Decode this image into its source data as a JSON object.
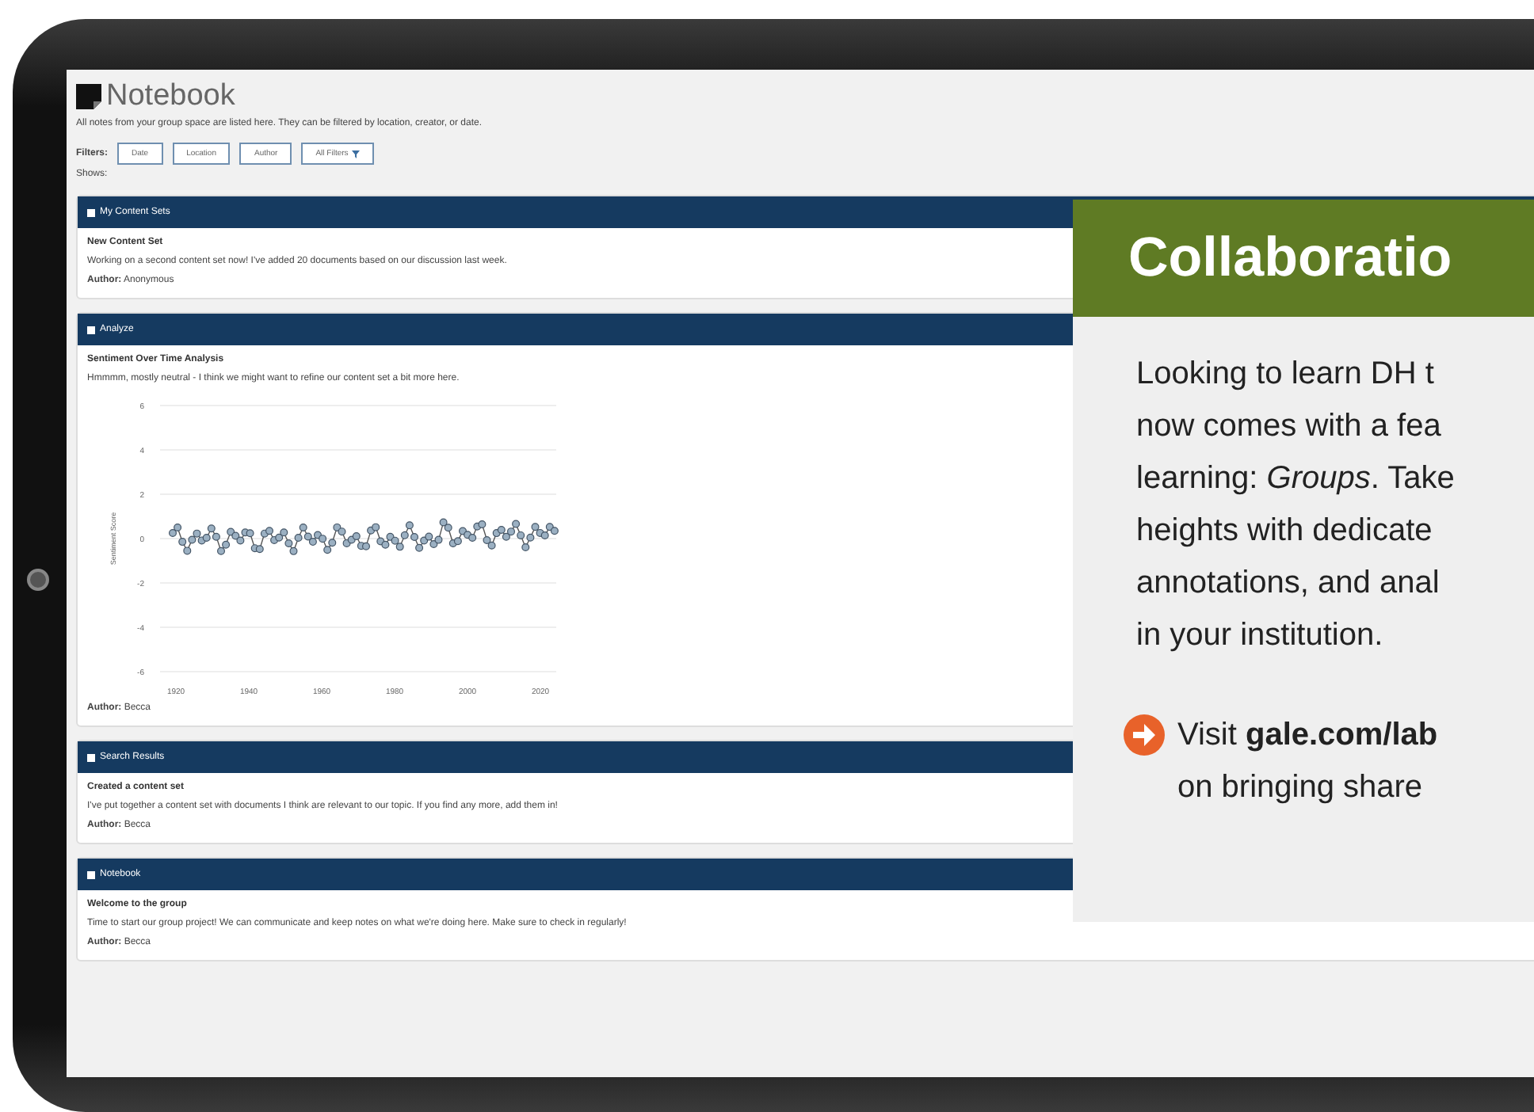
{
  "page": {
    "title": "Notebook",
    "description": "All notes from your group space are listed here. They can be filtered by location, creator, or date.",
    "filters_label": "Filters:",
    "filters": [
      {
        "label": "Date",
        "kind": "plain"
      },
      {
        "label": "Location",
        "kind": "plain"
      },
      {
        "label": "Author",
        "kind": "plain"
      },
      {
        "label": "All Filters",
        "kind": "dropdown"
      }
    ],
    "shows_label": "Shows:"
  },
  "panels": [
    {
      "header": "My Content Sets",
      "title": "New Content Set",
      "body": "Working on a second content set now! I've added 20 documents based on our discussion last week.",
      "author": "**Author:** Anonymous"
    },
    {
      "header": "Analyze",
      "title": "Sentiment Over Time Analysis",
      "body": "Hmmmm, mostly neutral - I think we might want to refine our content set a bit more here.",
      "chart": {
        "y_labels": [
          "6",
          "4",
          "2",
          "0",
          "-2",
          "-4",
          "-6"
        ],
        "x_labels": [
          "1920",
          "1940",
          "1960",
          "1980",
          "2000",
          "2020"
        ],
        "y_title": "Sentiment Score"
      },
      "author": "**Author:** Becca"
    },
    {
      "header": "Search Results",
      "title": "Created a content set",
      "body": "I've put together a content set with documents I think are relevant to our topic. If you find any more, add them in!",
      "author": "**Author:** Becca"
    },
    {
      "header": "Notebook",
      "title": "Welcome to the group",
      "body": "Time to start our group project! We can communicate and keep notes on what we're doing here. Make sure to check in regularly!",
      "author": "**Author:** Becca"
    }
  ],
  "promo": {
    "title": "Collaboratio",
    "lines": [
      "Looking to learn DH t",
      "now comes with a fea",
      "learning: *Groups*. Take",
      "heights with dedicate",
      "annotations, and anal",
      "in your institution."
    ],
    "link_lines": [
      "Visit **gale.com/lab**",
      "on bringing share"
    ]
  }
}
